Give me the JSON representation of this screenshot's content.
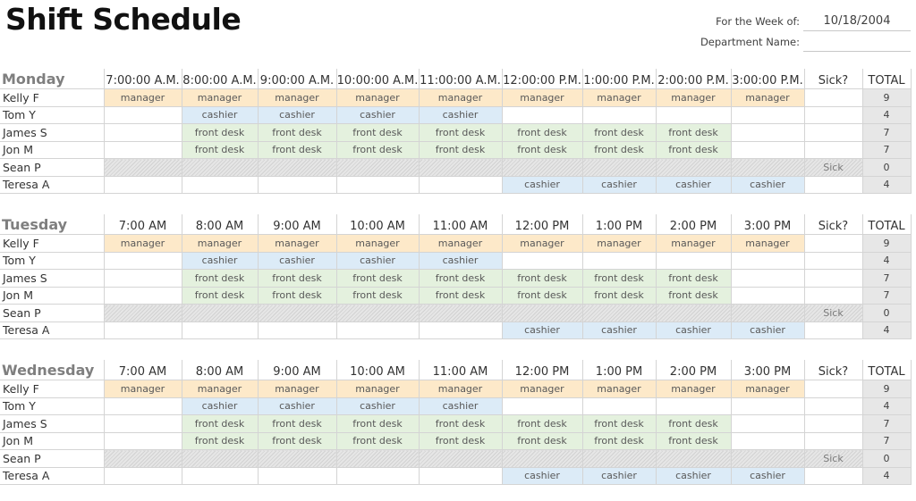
{
  "title": "Shift Schedule",
  "header": {
    "week_label": "For the Week of:",
    "week_value": "10/18/2004",
    "dept_label": "Department Name:",
    "dept_value": ""
  },
  "colors": {
    "manager": "#fde9c9",
    "cashier": "#dcebf7",
    "front_desk": "#e4f1de",
    "total": "#e7e7e7"
  },
  "days": [
    {
      "name": "Monday",
      "times": [
        "7:00:00 A.M.",
        "8:00:00 A.M.",
        "9:00:00 A.M.",
        "10:00:00 A.M.",
        "11:00:00 A.M.",
        "12:00:00 P.M.",
        "1:00:00 P.M.",
        "2:00:00 P.M.",
        "3:00:00 P.M."
      ],
      "sick_header": "Sick?",
      "total_header": "TOTAL",
      "rows": [
        {
          "name": "Kelly F",
          "shifts": [
            "manager",
            "manager",
            "manager",
            "manager",
            "manager",
            "manager",
            "manager",
            "manager",
            "manager"
          ],
          "sick": "",
          "total": "9"
        },
        {
          "name": "Tom Y",
          "shifts": [
            "",
            "cashier",
            "cashier",
            "cashier",
            "cashier",
            "",
            "",
            "",
            ""
          ],
          "sick": "",
          "total": "4"
        },
        {
          "name": "James S",
          "shifts": [
            "",
            "front desk",
            "front desk",
            "front desk",
            "front desk",
            "front desk",
            "front desk",
            "front desk",
            ""
          ],
          "sick": "",
          "total": "7"
        },
        {
          "name": "Jon M",
          "shifts": [
            "",
            "front desk",
            "front desk",
            "front desk",
            "front desk",
            "front desk",
            "front desk",
            "front desk",
            ""
          ],
          "sick": "",
          "total": "7"
        },
        {
          "name": "Sean P",
          "shifts": [
            "",
            "",
            "",
            "",
            "",
            "",
            "",
            "",
            ""
          ],
          "sick": "Sick",
          "total": "0"
        },
        {
          "name": "Teresa A",
          "shifts": [
            "",
            "",
            "",
            "",
            "",
            "cashier",
            "cashier",
            "cashier",
            "cashier"
          ],
          "sick": "",
          "total": "4"
        }
      ]
    },
    {
      "name": "Tuesday",
      "times": [
        "7:00 AM",
        "8:00 AM",
        "9:00 AM",
        "10:00 AM",
        "11:00 AM",
        "12:00 PM",
        "1:00 PM",
        "2:00 PM",
        "3:00 PM"
      ],
      "sick_header": "Sick?",
      "total_header": "TOTAL",
      "rows": [
        {
          "name": "Kelly F",
          "shifts": [
            "manager",
            "manager",
            "manager",
            "manager",
            "manager",
            "manager",
            "manager",
            "manager",
            "manager"
          ],
          "sick": "",
          "total": "9"
        },
        {
          "name": "Tom Y",
          "shifts": [
            "",
            "cashier",
            "cashier",
            "cashier",
            "cashier",
            "",
            "",
            "",
            ""
          ],
          "sick": "",
          "total": "4"
        },
        {
          "name": "James S",
          "shifts": [
            "",
            "front desk",
            "front desk",
            "front desk",
            "front desk",
            "front desk",
            "front desk",
            "front desk",
            ""
          ],
          "sick": "",
          "total": "7"
        },
        {
          "name": "Jon M",
          "shifts": [
            "",
            "front desk",
            "front desk",
            "front desk",
            "front desk",
            "front desk",
            "front desk",
            "front desk",
            ""
          ],
          "sick": "",
          "total": "7"
        },
        {
          "name": "Sean P",
          "shifts": [
            "",
            "",
            "",
            "",
            "",
            "",
            "",
            "",
            ""
          ],
          "sick": "Sick",
          "total": "0"
        },
        {
          "name": "Teresa A",
          "shifts": [
            "",
            "",
            "",
            "",
            "",
            "cashier",
            "cashier",
            "cashier",
            "cashier"
          ],
          "sick": "",
          "total": "4"
        }
      ]
    },
    {
      "name": "Wednesday",
      "times": [
        "7:00 AM",
        "8:00 AM",
        "9:00 AM",
        "10:00 AM",
        "11:00 AM",
        "12:00 PM",
        "1:00 PM",
        "2:00 PM",
        "3:00 PM"
      ],
      "sick_header": "Sick?",
      "total_header": "TOTAL",
      "rows": [
        {
          "name": "Kelly F",
          "shifts": [
            "manager",
            "manager",
            "manager",
            "manager",
            "manager",
            "manager",
            "manager",
            "manager",
            "manager"
          ],
          "sick": "",
          "total": "9"
        },
        {
          "name": "Tom Y",
          "shifts": [
            "",
            "cashier",
            "cashier",
            "cashier",
            "cashier",
            "",
            "",
            "",
            ""
          ],
          "sick": "",
          "total": "4"
        },
        {
          "name": "James S",
          "shifts": [
            "",
            "front desk",
            "front desk",
            "front desk",
            "front desk",
            "front desk",
            "front desk",
            "front desk",
            ""
          ],
          "sick": "",
          "total": "7"
        },
        {
          "name": "Jon M",
          "shifts": [
            "",
            "front desk",
            "front desk",
            "front desk",
            "front desk",
            "front desk",
            "front desk",
            "front desk",
            ""
          ],
          "sick": "",
          "total": "7"
        },
        {
          "name": "Sean P",
          "shifts": [
            "",
            "",
            "",
            "",
            "",
            "",
            "",
            "",
            ""
          ],
          "sick": "Sick",
          "total": "0"
        },
        {
          "name": "Teresa A",
          "shifts": [
            "",
            "",
            "",
            "",
            "",
            "cashier",
            "cashier",
            "cashier",
            "cashier"
          ],
          "sick": "",
          "total": "4"
        }
      ]
    }
  ]
}
